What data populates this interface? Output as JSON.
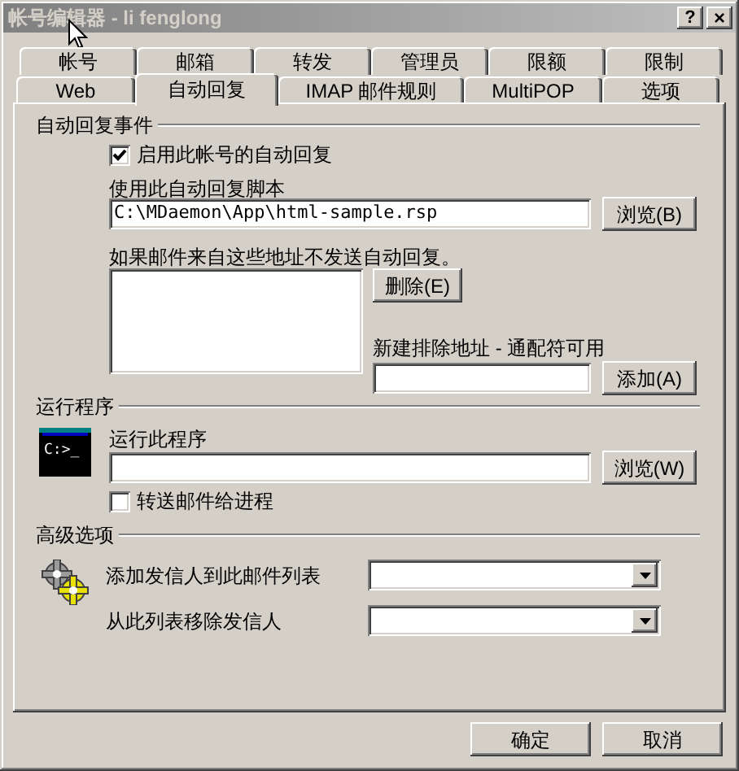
{
  "window": {
    "title": "帐号编辑器 - li fenglong",
    "help_button": "?",
    "close_button": "×"
  },
  "tab_rows": [
    {
      "tabs": [
        {
          "label": "帐号",
          "selected": false
        },
        {
          "label": "邮箱",
          "selected": false
        },
        {
          "label": "转发",
          "selected": false
        },
        {
          "label": "管理员",
          "selected": false
        },
        {
          "label": "限额",
          "selected": false
        },
        {
          "label": "限制",
          "selected": false
        }
      ]
    },
    {
      "tabs": [
        {
          "label": "Web",
          "selected": false
        },
        {
          "label": "自动回复",
          "selected": true
        },
        {
          "label": "IMAP 邮件规则",
          "selected": false
        },
        {
          "label": "MultiPOP",
          "selected": false
        },
        {
          "label": "选项",
          "selected": false
        }
      ]
    }
  ],
  "auto_reply": {
    "heading": "自动回复事件",
    "enable_checkbox": {
      "label": "启用此帐号的自动回复",
      "checked": true
    },
    "script_label": "使用此自动回复脚本",
    "script_path": "C:\\MDaemon\\App\\html-sample.rsp",
    "browse_button": "浏览(B)",
    "exclude_label": "如果邮件来自这些地址不发送自动回复。",
    "delete_button": "删除(E)",
    "new_exclude_label": "新建排除地址 - 通配符可用",
    "add_button": "添加(A)"
  },
  "run_program": {
    "heading": "运行程序",
    "console_icon_text": "C:>_",
    "label": "运行此程序",
    "browse_button": "浏览(W)",
    "forward_checkbox": {
      "label": "转送邮件给进程",
      "checked": false
    }
  },
  "advanced": {
    "heading": "高级选项",
    "add_sender_label": "添加发信人到此邮件列表",
    "remove_sender_label": "从此列表移除发信人"
  },
  "buttons": [
    "确定",
    "取消"
  ]
}
